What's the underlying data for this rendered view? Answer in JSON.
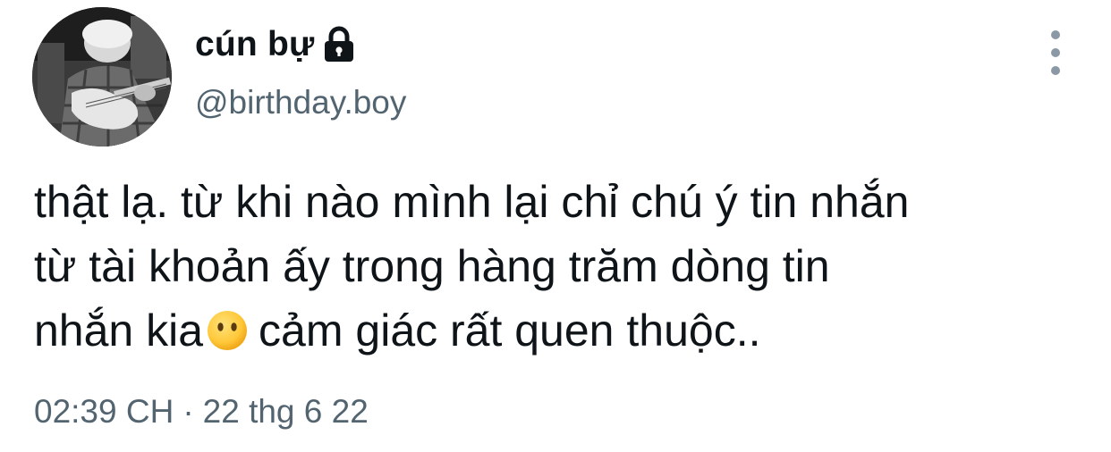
{
  "author": {
    "display_name": "cún bự",
    "handle": "@birthday.boy",
    "avatar_icon": "avatar-photo",
    "protected_icon": "lock-icon"
  },
  "tweet": {
    "lines": [
      "thật lạ. từ khi nào mình lại chỉ chú ý tin nhắn",
      "từ tài khoản ấy trong hàng trăm dòng tin",
      "nhắn kia",
      "cảm giác rất quen thuộc.."
    ],
    "emoji": "face-without-mouth-emoji"
  },
  "meta": {
    "time": "02:39 CH",
    "separator": "·",
    "date": "22 thg 6 22"
  },
  "actions": {
    "more_icon": "more-vertical-icon"
  },
  "colors": {
    "text_primary": "#0f1419",
    "text_secondary": "#536471",
    "more_dots": "#8b98a5"
  }
}
